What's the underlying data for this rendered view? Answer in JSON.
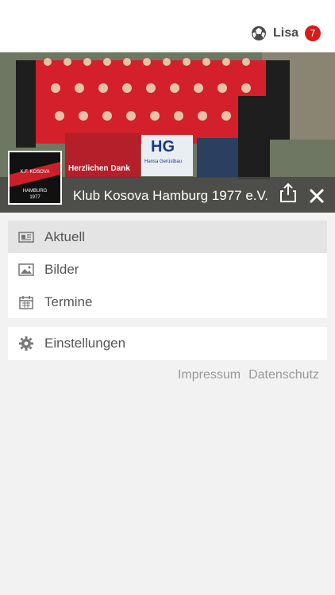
{
  "header": {
    "user_name": "Lisa",
    "notification_count": "7"
  },
  "club": {
    "name": "Klub Kosova Hamburg 1977 e.V.",
    "logo_text_top": "K.F. KOSOVA",
    "logo_text_mid": "HAMBURG",
    "logo_text_bottom": "1977"
  },
  "banners": {
    "left_text": "Herzlichen Dank",
    "right_logo": "HG",
    "right_text": "Hansa Gerüstbau"
  },
  "menu": {
    "items": [
      {
        "label": "Aktuell",
        "icon": "newspaper-icon",
        "active": true
      },
      {
        "label": "Bilder",
        "icon": "image-icon",
        "active": false
      },
      {
        "label": "Termine",
        "icon": "calendar-icon",
        "active": false
      }
    ],
    "settings_label": "Einstellungen"
  },
  "footer": {
    "impressum": "Impressum",
    "datenschutz": "Datenschutz"
  },
  "colors": {
    "badge": "#d91a1a",
    "club_bar": "#464646",
    "active_item": "#e4e4e4",
    "team_red": "#d3202a"
  }
}
